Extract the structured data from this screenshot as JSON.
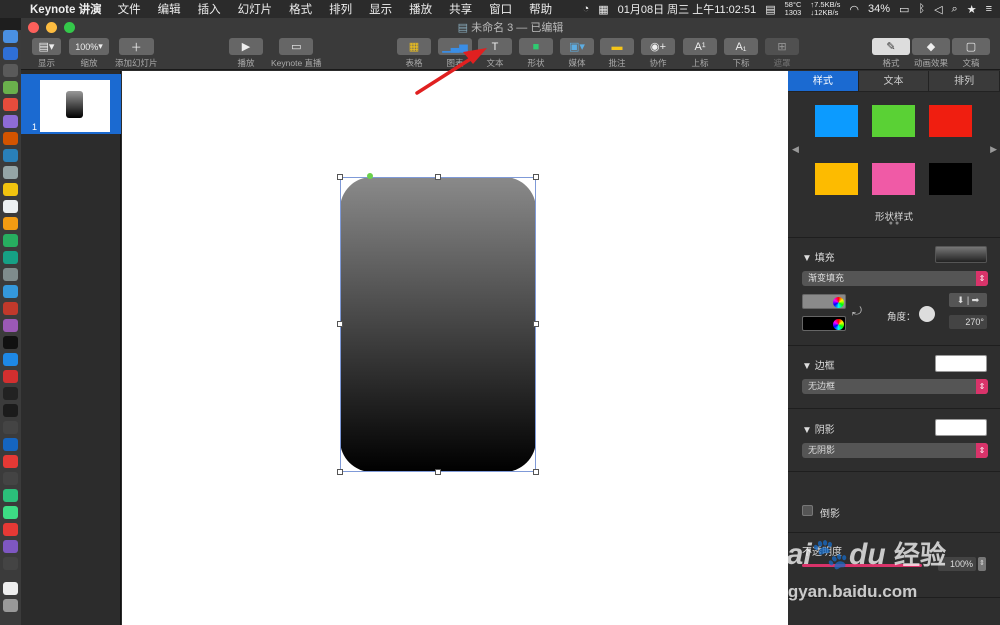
{
  "menubar": {
    "app_name": "Keynote 讲演",
    "items": [
      "文件",
      "编辑",
      "插入",
      "幻灯片",
      "格式",
      "排列",
      "显示",
      "播放",
      "共享",
      "窗口",
      "帮助"
    ],
    "datetime": "01月08日 周三 上午11:02:51",
    "temp": "58°C",
    "fan": "1303",
    "net_up": "↑7.5KB/s",
    "net_down": "↓12KB/s",
    "battery": "34%"
  },
  "window": {
    "title": "未命名 3 — 已编辑",
    "toolbar": {
      "view": "显示",
      "zoom_value": "100%",
      "zoom": "缩放",
      "add_slide": "添加幻灯片",
      "play": "播放",
      "keynote_live": "Keynote 直播",
      "table": "表格",
      "chart": "图表",
      "text": "文本",
      "shape": "形状",
      "media": "媒体",
      "comment": "批注",
      "collaborate": "协作",
      "superscript": "上标",
      "subscript": "下标",
      "mask": "遮罩",
      "format": "格式",
      "animate": "动画效果",
      "document": "文稿"
    }
  },
  "navigator": {
    "slide_number": "1"
  },
  "inspector": {
    "tabs": [
      "样式",
      "文本",
      "排列"
    ],
    "shape_styles_label": "形状样式",
    "swatch_colors": [
      "#0c9bff",
      "#5ad135",
      "#f01e10",
      "#fdbb00",
      "#f05aa6",
      "#000000"
    ],
    "fill_label": "填充",
    "fill_type": "渐变填充",
    "gradient_start": "#8a8a8a",
    "gradient_end": "#000000",
    "angle_label": "角度：",
    "angle_value": "270°",
    "border_label": "边框",
    "border_value": "无边框",
    "shadow_label": "阴影",
    "shadow_value": "无阴影",
    "reflection_label": "倒影",
    "opacity_label": "不透明度",
    "opacity_value": "100%"
  },
  "watermark": {
    "brand_a": "Bai",
    "brand_b": "du",
    "brand_cn": "经验",
    "url": "jingyan.baidu.com"
  }
}
